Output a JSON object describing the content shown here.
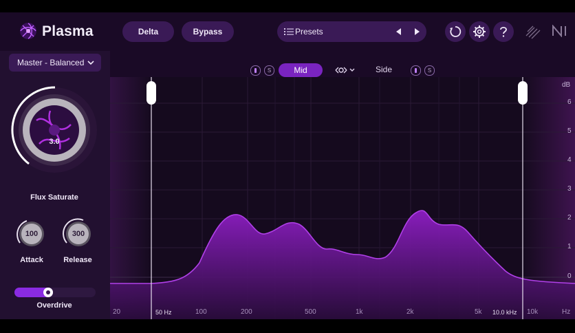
{
  "app": {
    "name": "Plasma"
  },
  "header": {
    "delta_label": "Delta",
    "bypass_label": "Bypass",
    "presets_label": "Presets"
  },
  "sidebar": {
    "preset_dropdown": "Master - Balanced",
    "flux": {
      "value": "3.0",
      "label": "Flux Saturate",
      "level": 0.6
    },
    "attack": {
      "value": "100",
      "label": "Attack"
    },
    "release": {
      "value": "300",
      "label": "Release"
    },
    "overdrive": {
      "label": "Overdrive",
      "level": 0.4
    }
  },
  "band_bar": {
    "mid_label": "Mid",
    "side_label": "Side",
    "solo_label": "S"
  },
  "graph": {
    "db_unit": "dB",
    "db_ticks": [
      "6",
      "5",
      "4",
      "3",
      "2",
      "1",
      "0"
    ],
    "hz_ticks": [
      "20",
      "100",
      "200",
      "500",
      "1k",
      "2k",
      "5k",
      "10k",
      "Hz"
    ],
    "low_marker_label": "50 Hz",
    "high_marker_label": "10.0 kHz"
  },
  "colors": {
    "accent": "#8a2be2",
    "background": "#1e0a2c"
  }
}
